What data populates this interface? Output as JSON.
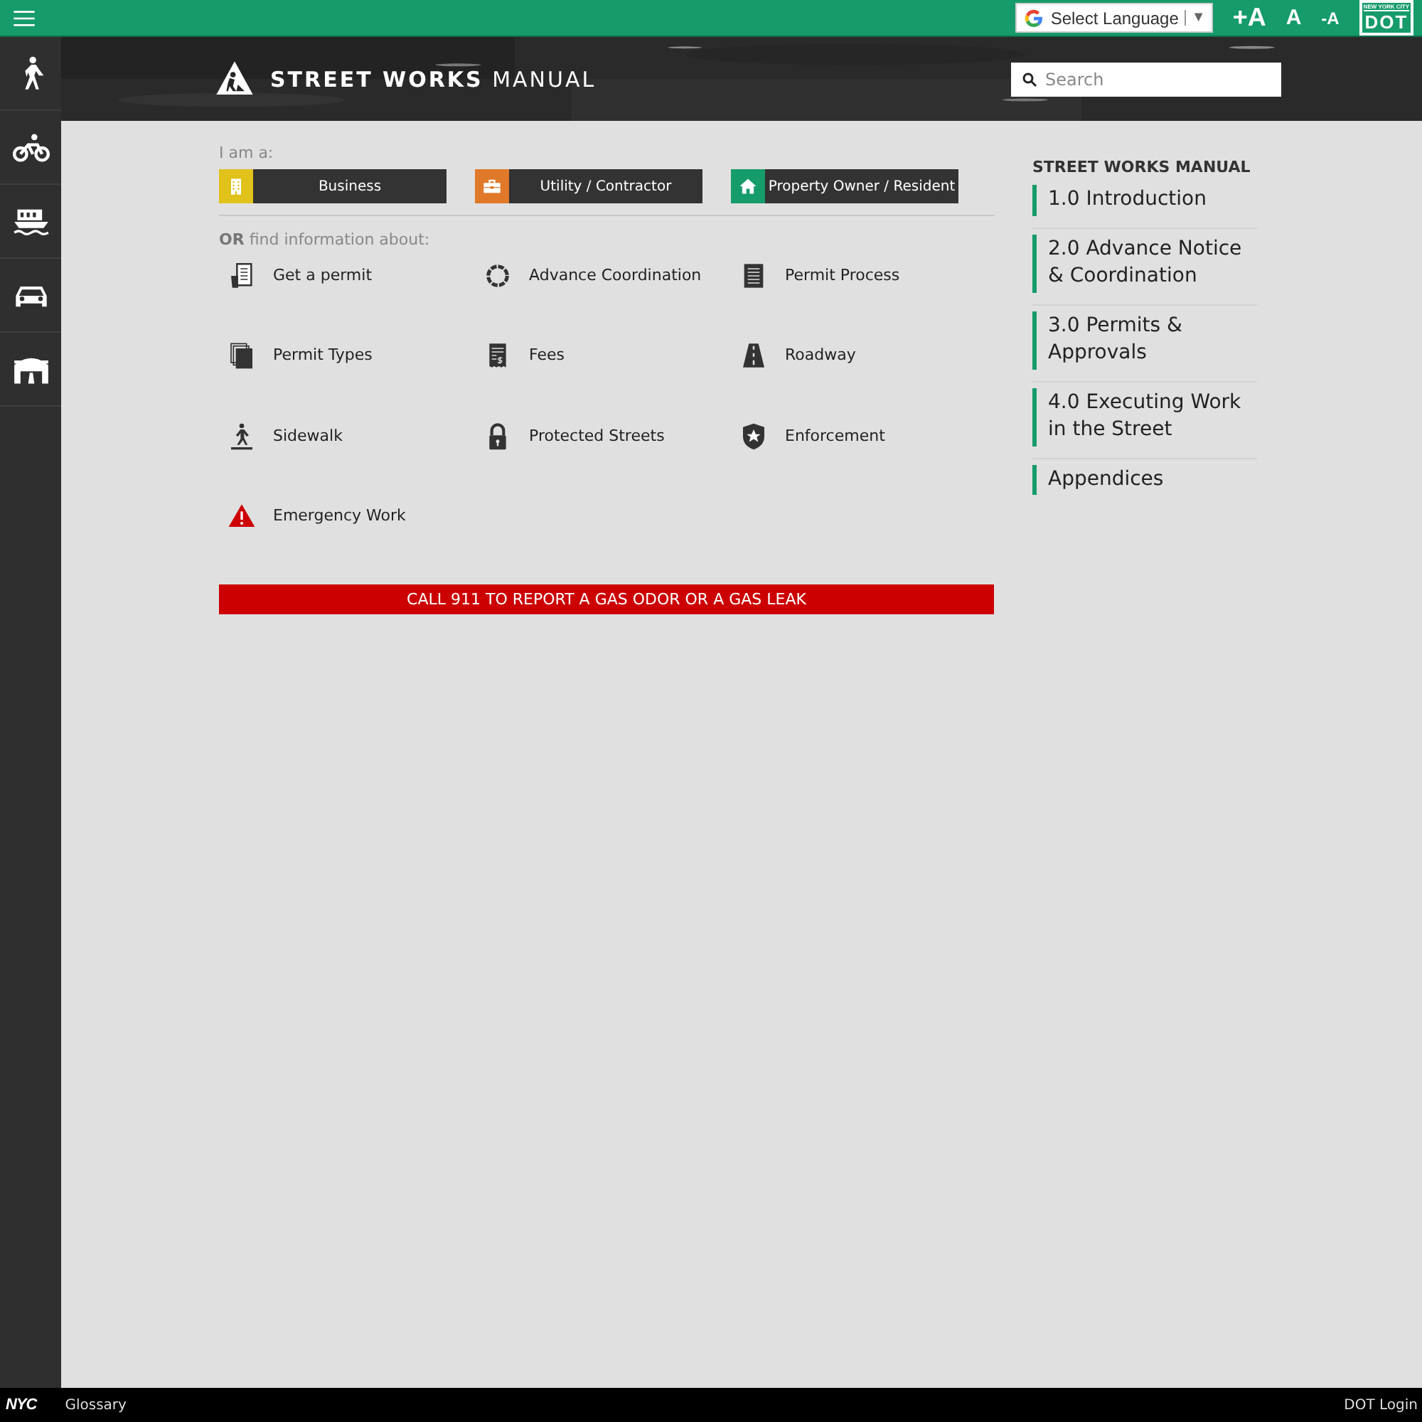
{
  "top_bar": {
    "language": "Select Language",
    "language_caret": "▼",
    "text_size": [
      "+A",
      "A",
      "-A"
    ],
    "logo": {
      "line1": "NEW YORK CITY",
      "line2": "DOT"
    }
  },
  "header": {
    "title_bold": "STREET WORKS",
    "title_light": "MANUAL",
    "search": {
      "placeholder": "Search"
    }
  },
  "roles": {
    "label": "I am a:",
    "items": [
      {
        "label": "Business",
        "color": "#e0c21a"
      },
      {
        "label": "Utility / Contractor",
        "color": "#e07a2a"
      },
      {
        "label": "Property Owner / Resident",
        "color": "#169b6b"
      }
    ]
  },
  "topics": {
    "label": "**OR** find information about:",
    "items": [
      {
        "label": "Get a permit"
      },
      {
        "label": "Advance Coordination"
      },
      {
        "label": "Permit Process"
      },
      {
        "label": "Permit Types"
      },
      {
        "label": "Fees"
      },
      {
        "label": "Roadway"
      },
      {
        "label": "Sidewalk"
      },
      {
        "label": "Protected Streets"
      },
      {
        "label": "Enforcement"
      },
      {
        "label": "Emergency Work"
      }
    ]
  },
  "alert": "CALL 911 TO REPORT A GAS ODOR OR A GAS LEAK",
  "toc": {
    "title": "STREET WORKS MANUAL",
    "items": [
      "1.0 Introduction",
      "2.0 Advance Notice & Coordination",
      "3.0 Permits & Approvals",
      "4.0 Executing Work in the Street",
      "Appendices"
    ]
  },
  "footer": {
    "logo": "NYC",
    "links": [
      "Glossary",
      "DOT Login"
    ]
  }
}
